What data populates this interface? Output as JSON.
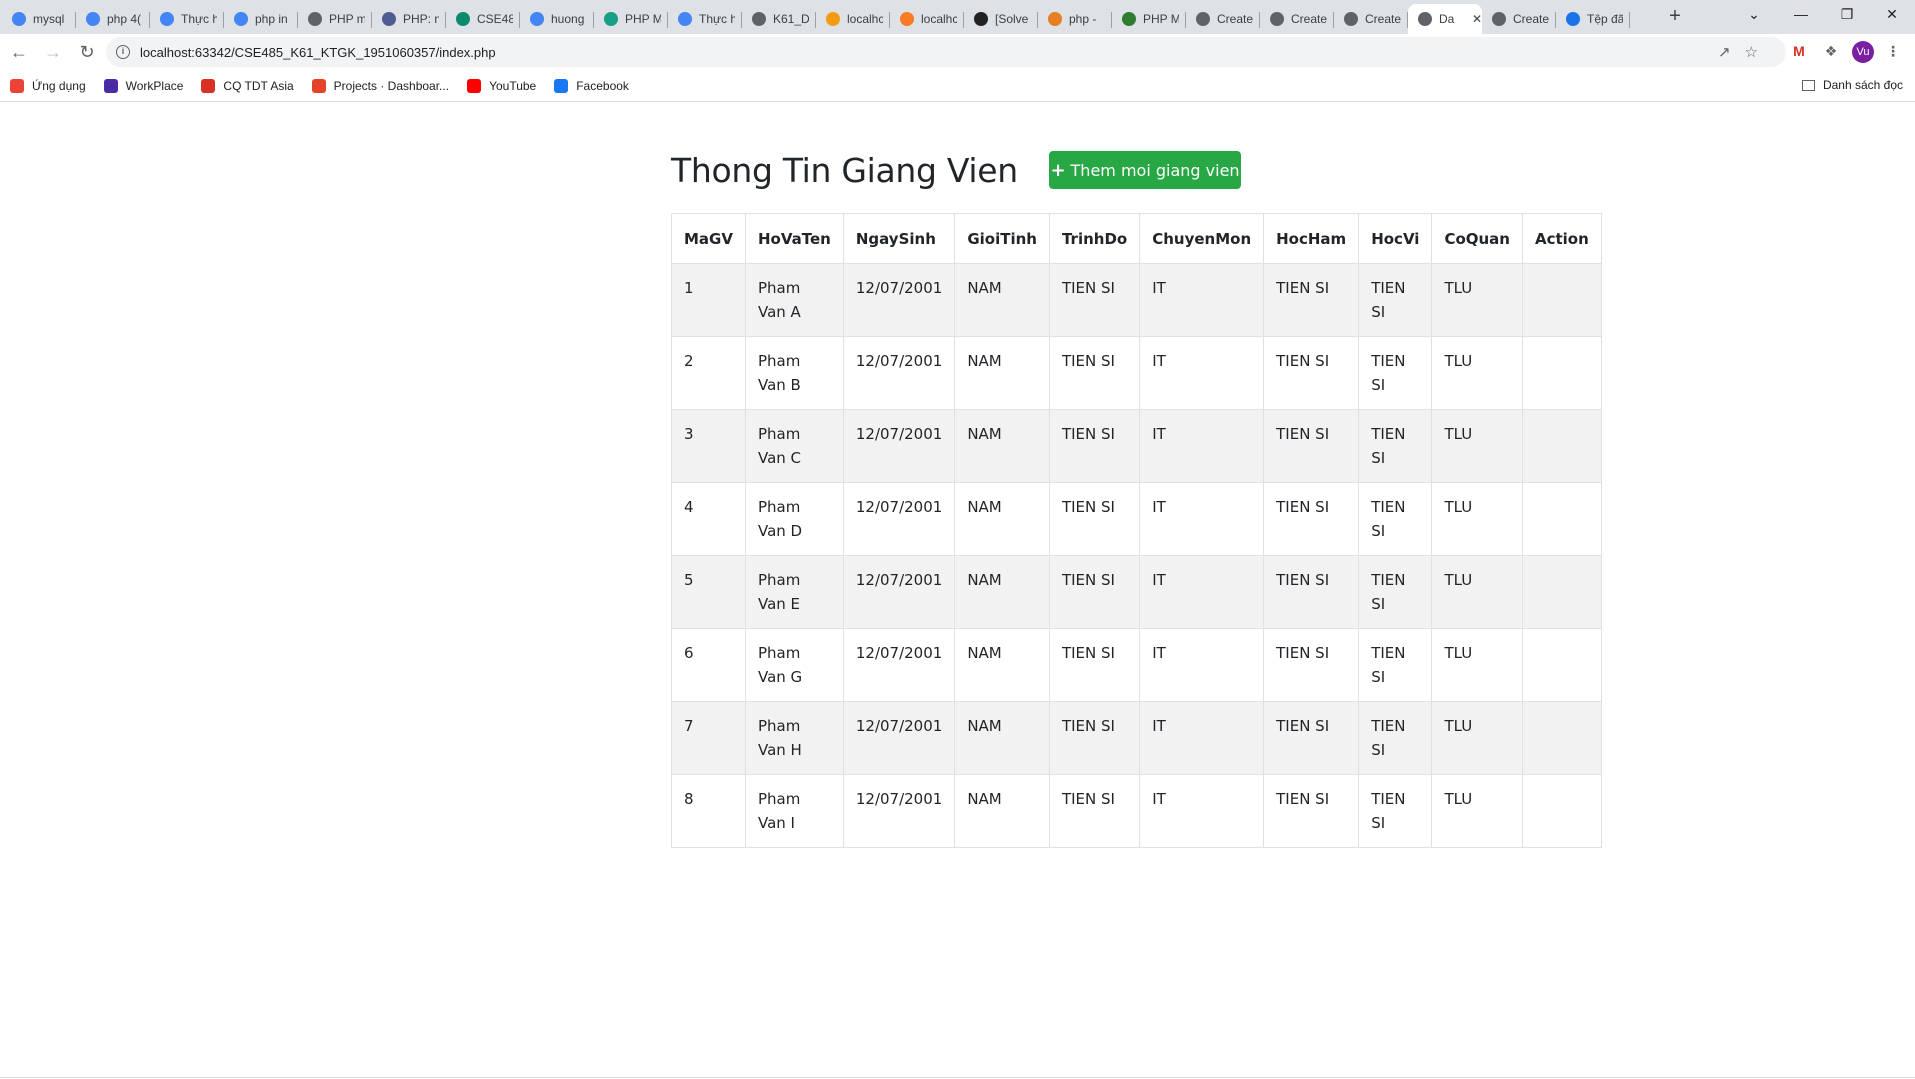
{
  "browser": {
    "tabs": [
      {
        "label": "mysql",
        "icon": "google-icon",
        "color": "#4285f4"
      },
      {
        "label": "php 4(",
        "icon": "google-icon",
        "color": "#4285f4"
      },
      {
        "label": "Thực h",
        "icon": "translate-icon",
        "color": "#4285f4"
      },
      {
        "label": "php in",
        "icon": "google-icon",
        "color": "#4285f4"
      },
      {
        "label": "PHP m",
        "icon": "diamond-icon",
        "color": "#5f6368"
      },
      {
        "label": "PHP: n",
        "icon": "php-icon",
        "color": "#4f5b93"
      },
      {
        "label": "CSE48",
        "icon": "dots-icon",
        "color": "#0b8a6e"
      },
      {
        "label": "huong",
        "icon": "google-icon",
        "color": "#4285f4"
      },
      {
        "label": "PHP M",
        "icon": "shield-icon",
        "color": "#16a085"
      },
      {
        "label": "Thực h",
        "icon": "translate-icon",
        "color": "#4285f4"
      },
      {
        "label": "K61_D",
        "icon": "globe-icon",
        "color": "#5f6368"
      },
      {
        "label": "localhc",
        "icon": "phpmyadmin-icon",
        "color": "#f39c12"
      },
      {
        "label": "localhc",
        "icon": "xampp-icon",
        "color": "#fb7a24"
      },
      {
        "label": "[Solve",
        "icon": "stack-icon",
        "color": "#222222"
      },
      {
        "label": "php -",
        "icon": "flame-icon",
        "color": "#e67e22"
      },
      {
        "label": "PHP M",
        "icon": "w-icon",
        "color": "#2e7d32"
      },
      {
        "label": "Create",
        "icon": "globe-icon",
        "color": "#5f6368"
      },
      {
        "label": "Create",
        "icon": "globe-icon",
        "color": "#5f6368"
      },
      {
        "label": "Create",
        "icon": "globe-icon",
        "color": "#5f6368"
      },
      {
        "label": "Da",
        "icon": "globe-icon",
        "color": "#5f6368",
        "active": true
      },
      {
        "label": "Create",
        "icon": "globe-icon",
        "color": "#5f6368"
      },
      {
        "label": "Tệp đã",
        "icon": "download-icon",
        "color": "#1a73e8"
      }
    ],
    "url": "localhost:63342/CSE485_K61_KTGK_1951060357/index.php",
    "avatar_text": "Vu",
    "bookmarks": [
      {
        "label": "Ứng dụng",
        "icon": "apps-grid-icon",
        "color": "#ea4335"
      },
      {
        "label": "WorkPlace",
        "icon": "workplace-icon",
        "color": "#4a2ba3"
      },
      {
        "label": "CQ TDT Asia",
        "icon": "cq-icon",
        "color": "#d93025"
      },
      {
        "label": "Projects · Dashboar...",
        "icon": "gitlab-icon",
        "color": "#e24329"
      },
      {
        "label": "YouTube",
        "icon": "youtube-icon",
        "color": "#ff0000"
      },
      {
        "label": "Facebook",
        "icon": "facebook-icon",
        "color": "#1877f2"
      }
    ],
    "reading_list": "Danh sách đọc"
  },
  "page": {
    "title": "Thong Tin Giang Vien",
    "add_button": "Them moi giang vien",
    "accent_color": "#28a745",
    "table": {
      "headers": [
        "MaGV",
        "HoVaTen",
        "NgaySinh",
        "GioiTinh",
        "TrinhDo",
        "ChuyenMon",
        "HocHam",
        "HocVi",
        "CoQuan",
        "Action"
      ],
      "rows": [
        [
          "1",
          "Pham Van A",
          "12/07/2001",
          "NAM",
          "TIEN SI",
          "IT",
          "TIEN SI",
          "TIEN SI",
          "TLU",
          ""
        ],
        [
          "2",
          "Pham Van B",
          "12/07/2001",
          "NAM",
          "TIEN SI",
          "IT",
          "TIEN SI",
          "TIEN SI",
          "TLU",
          ""
        ],
        [
          "3",
          "Pham Van C",
          "12/07/2001",
          "NAM",
          "TIEN SI",
          "IT",
          "TIEN SI",
          "TIEN SI",
          "TLU",
          ""
        ],
        [
          "4",
          "Pham Van D",
          "12/07/2001",
          "NAM",
          "TIEN SI",
          "IT",
          "TIEN SI",
          "TIEN SI",
          "TLU",
          ""
        ],
        [
          "5",
          "Pham Van E",
          "12/07/2001",
          "NAM",
          "TIEN SI",
          "IT",
          "TIEN SI",
          "TIEN SI",
          "TLU",
          ""
        ],
        [
          "6",
          "Pham Van G",
          "12/07/2001",
          "NAM",
          "TIEN SI",
          "IT",
          "TIEN SI",
          "TIEN SI",
          "TLU",
          ""
        ],
        [
          "7",
          "Pham Van H",
          "12/07/2001",
          "NAM",
          "TIEN SI",
          "IT",
          "TIEN SI",
          "TIEN SI",
          "TLU",
          ""
        ],
        [
          "8",
          "Pham Van I",
          "12/07/2001",
          "NAM",
          "TIEN SI",
          "IT",
          "TIEN SI",
          "TIEN SI",
          "TLU",
          ""
        ]
      ]
    }
  }
}
